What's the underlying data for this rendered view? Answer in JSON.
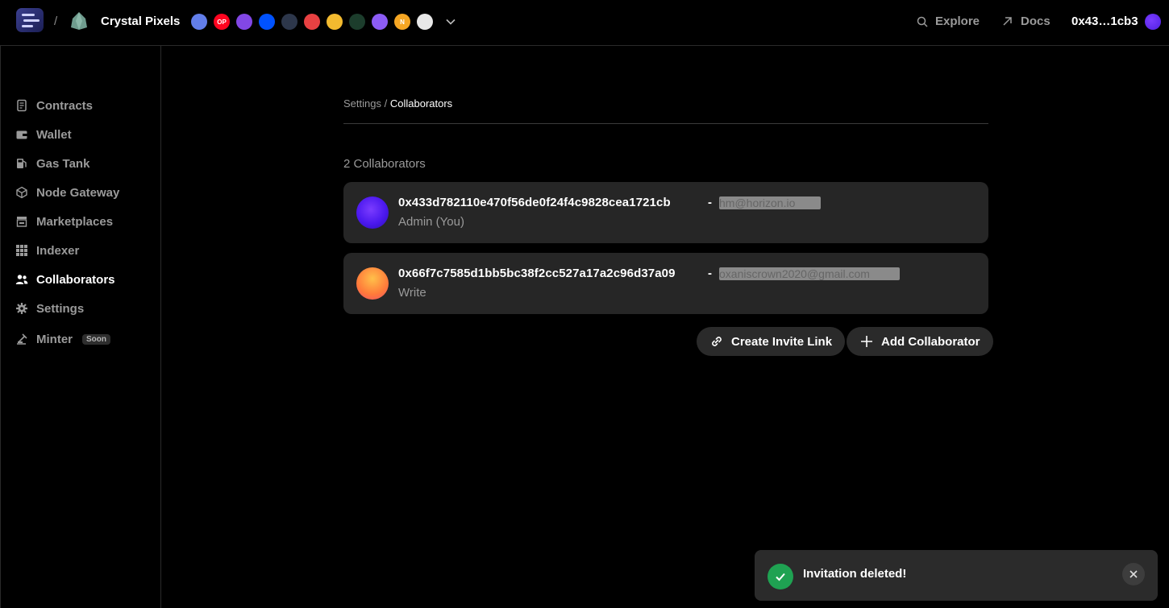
{
  "header": {
    "separator": "/",
    "project_name": "Crystal Pixels",
    "chains": [
      {
        "icon": "ethereum-icon",
        "label": "",
        "color": "#627eea"
      },
      {
        "icon": "optimism-icon",
        "label": "OP",
        "color": "#ff0420"
      },
      {
        "icon": "polygon-icon",
        "label": "",
        "color": "#8247e5"
      },
      {
        "icon": "base-icon",
        "label": "",
        "color": "#0052ff"
      },
      {
        "icon": "arbitrum-icon",
        "label": "",
        "color": "#2d374b"
      },
      {
        "icon": "avalanche-icon",
        "label": "",
        "color": "#e84142"
      },
      {
        "icon": "bnb-icon",
        "label": "",
        "color": "#f3ba2f"
      },
      {
        "icon": "gnosis-icon",
        "label": "",
        "color": "#1c3d2c"
      },
      {
        "icon": "zksync-icon",
        "label": "",
        "color": "#8c5cf5"
      },
      {
        "icon": "near-icon",
        "label": "N",
        "color": "#f5a623"
      },
      {
        "icon": "linea-icon",
        "label": "",
        "color": "#e8e8e8"
      }
    ],
    "explore_label": "Explore",
    "docs_label": "Docs",
    "wallet_address": "0x43…1cb3"
  },
  "sidebar": {
    "items": [
      {
        "label": "Contracts",
        "icon": "contract-icon"
      },
      {
        "label": "Wallet",
        "icon": "wallet-icon"
      },
      {
        "label": "Gas Tank",
        "icon": "gas-pump-icon"
      },
      {
        "label": "Node Gateway",
        "icon": "cube-icon"
      },
      {
        "label": "Marketplaces",
        "icon": "store-icon"
      },
      {
        "label": "Indexer",
        "icon": "grid-icon"
      },
      {
        "label": "Collaborators",
        "icon": "users-icon"
      },
      {
        "label": "Settings",
        "icon": "gear-icon"
      },
      {
        "label": "Minter",
        "icon": "minter-icon",
        "badge": "Soon"
      }
    ]
  },
  "main": {
    "breadcrumb_parent": "Settings",
    "breadcrumb_sep": "/",
    "breadcrumb_current": "Collaborators",
    "count_label": "2 Collaborators",
    "collaborators": [
      {
        "address": "0x433d782110e470f56de0f24f4c9828cea1721cb",
        "dash": "-",
        "email": "hm@horizon.io",
        "role": "Admin (You)"
      },
      {
        "address": "0x66f7c7585d1bb5bc38f2cc527a17a2c96d37a09",
        "dash": "-",
        "email": "oxaniscrown2020@gmail.com",
        "role": "Write"
      }
    ],
    "create_invite_label": "Create Invite Link",
    "add_collaborator_label": "Add Collaborator"
  },
  "toast": {
    "message": "Invitation deleted!"
  },
  "colors": {
    "background": "#000000",
    "card": "#262626",
    "success": "#1fa252",
    "muted_text": "#9a9a9a"
  }
}
